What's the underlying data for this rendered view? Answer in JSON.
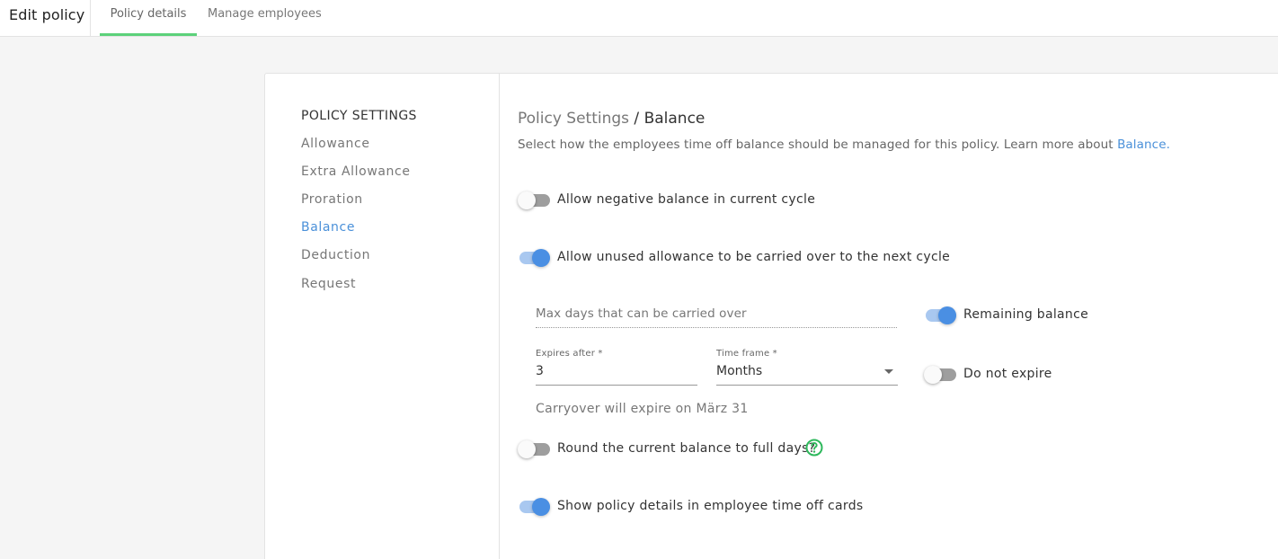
{
  "header": {
    "title": "Edit policy",
    "tabs": [
      {
        "label": "Policy details",
        "active": true
      },
      {
        "label": "Manage employees",
        "active": false
      }
    ],
    "active_tab_color": "#5cd17a"
  },
  "sidebar": {
    "header": "POLICY SETTINGS",
    "items": [
      {
        "label": "Allowance"
      },
      {
        "label": "Extra Allowance"
      },
      {
        "label": "Proration"
      },
      {
        "label": "Balance",
        "active": true
      },
      {
        "label": "Deduction"
      },
      {
        "label": "Request"
      }
    ],
    "active_color": "#4a90d9"
  },
  "main": {
    "breadcrumb_parent": "Policy Settings",
    "breadcrumb_separator": " / ",
    "breadcrumb_current": "Balance",
    "description": "Select how the employees time off balance should be managed for this policy. Learn more about ",
    "description_link": "Balance.",
    "toggles": {
      "negative_balance": {
        "label": "Allow negative balance in current cycle",
        "on": false
      },
      "carry_over": {
        "label": "Allow unused allowance to be carried over to the next cycle",
        "on": true
      },
      "remaining_balance": {
        "label": "Remaining balance",
        "on": true
      },
      "do_not_expire": {
        "label": "Do not expire",
        "on": false
      },
      "round_balance": {
        "label": "Round the current balance to full days?",
        "on": false
      },
      "show_details": {
        "label": "Show policy details in employee time off cards",
        "on": true
      }
    },
    "max_days_placeholder": "Max days that can be carried over",
    "expires_after": {
      "label": "Expires after *",
      "value": "3"
    },
    "time_frame": {
      "label": "Time frame *",
      "value": "Months"
    },
    "expiry_note": "Carryover will expire on März 31",
    "help_icon": "question-circle-icon",
    "help_icon_color": "#2eb85c",
    "toggle_on_color": "#4a8fe3"
  }
}
